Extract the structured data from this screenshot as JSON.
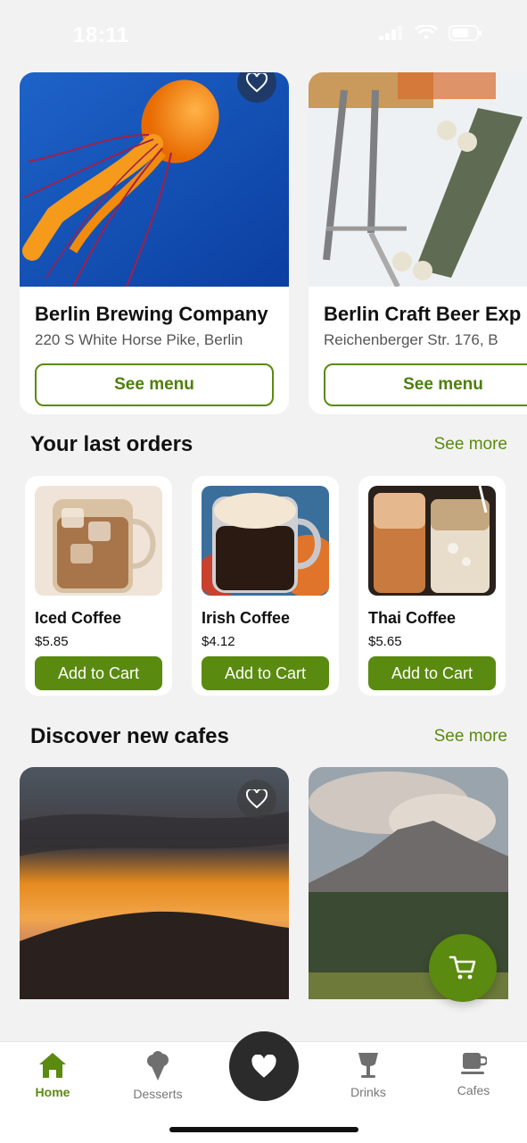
{
  "status": {
    "time": "18:11"
  },
  "featured": [
    {
      "name": "Berlin Brewing Company",
      "address": "220 S White Horse Pike, Berlin",
      "button": "See menu"
    },
    {
      "name": "Berlin Craft Beer Exp",
      "address": "Reichenberger Str. 176, B",
      "button": "See menu"
    }
  ],
  "orders_section": {
    "title": "Your last orders",
    "see_more": "See more"
  },
  "orders": [
    {
      "name": "Iced Coffee",
      "price": "$5.85",
      "button": "Add to Cart"
    },
    {
      "name": "Irish Coffee",
      "price": "$4.12",
      "button": "Add to Cart"
    },
    {
      "name": "Thai Coffee",
      "price": "$5.65",
      "button": "Add to Cart"
    }
  ],
  "discover_section": {
    "title": "Discover new cafes",
    "see_more": "See more"
  },
  "nav": [
    {
      "label": "Home",
      "icon": "home-icon",
      "active": true
    },
    {
      "label": "Desserts",
      "icon": "ice-cream-icon"
    },
    {
      "label": "",
      "icon": "heart-icon"
    },
    {
      "label": "Drinks",
      "icon": "glass-icon"
    },
    {
      "label": "Cafes",
      "icon": "coffee-cup-icon"
    }
  ],
  "colors": {
    "accent": "#5a8a0f",
    "background": "#f2f2f2",
    "fab_center": "#2b2b2b"
  }
}
